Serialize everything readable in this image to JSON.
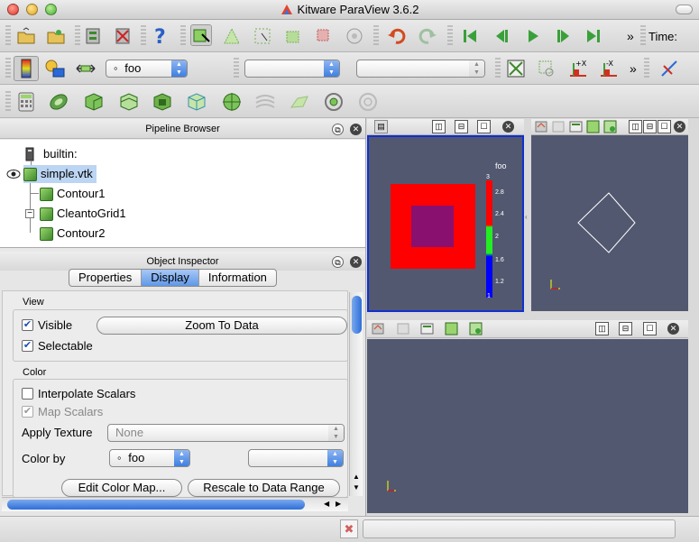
{
  "window": {
    "title": "Kitware ParaView 3.6.2"
  },
  "toolbar": {
    "time_label": "Time:",
    "overflow": "»",
    "array_combo": "foo",
    "array_combo_marker": "◦"
  },
  "panels": {
    "pipeline": {
      "title": "Pipeline Browser",
      "items": [
        {
          "label": "builtin:"
        },
        {
          "label": "simple.vtk"
        },
        {
          "label": "Contour1"
        },
        {
          "label": "CleantoGrid1"
        },
        {
          "label": "Contour2"
        }
      ]
    },
    "inspector": {
      "title": "Object Inspector",
      "tabs": [
        {
          "label": "Properties"
        },
        {
          "label": "Display"
        },
        {
          "label": "Information"
        }
      ],
      "view_section": {
        "title": "View",
        "visible": "Visible",
        "selectable": "Selectable",
        "zoom": "Zoom To Data"
      },
      "color_section": {
        "title": "Color",
        "interpolate": "Interpolate Scalars",
        "map": "Map Scalars",
        "apply_texture": "Apply Texture",
        "texture_value": "None",
        "color_by": "Color by",
        "color_by_value": "foo",
        "edit_map": "Edit Color Map...",
        "rescale": "Rescale to Data Range"
      }
    }
  },
  "views": {
    "colorbar": {
      "title": "foo",
      "ticks": [
        "3",
        "2.8",
        "2.4",
        "2",
        "1.6",
        "1.2",
        "1"
      ]
    }
  },
  "colors": {
    "accent": "#3f7fdf",
    "view_bg": "#525870",
    "active_border": "#1030d0",
    "outer_square": "#ff0000",
    "inner_square": "#8a1070"
  }
}
